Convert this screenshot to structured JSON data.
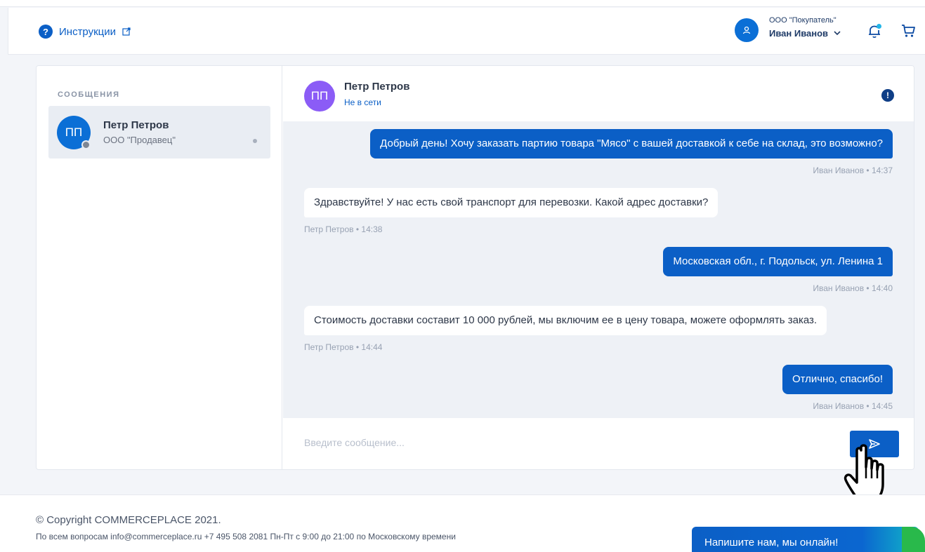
{
  "header": {
    "help_label": "Инструкции",
    "user": {
      "company": "ООО \"Покупатель\"",
      "name": "Иван Иванов"
    }
  },
  "sidebar": {
    "title": "СООБЩЕНИЯ",
    "contacts": [
      {
        "initials": "ПП",
        "name": "Петр Петров",
        "company": "ООО \"Продавец\""
      }
    ]
  },
  "chat": {
    "initials": "ПП",
    "name": "Петр Петров",
    "status": "Не в сети",
    "messages": [
      {
        "direction": "out",
        "text": "Добрый день! Хочу заказать партию товара  \"Мясо\"  с вашей доставкой к себе на склад, это возможно?",
        "meta": "Иван Иванов • 14:37"
      },
      {
        "direction": "in",
        "text": "Здравствуйте! У нас есть свой транспорт для перевозки. Какой адрес доставки?",
        "meta": "Петр Петров • 14:38"
      },
      {
        "direction": "out",
        "text": "Московская обл., г. Подольск, ул. Ленина 1",
        "meta": "Иван Иванов • 14:40"
      },
      {
        "direction": "in",
        "text": "Стоимость доставки составит 10 000 рублей, мы включим ее в цену товара, можете оформлять заказ.",
        "meta": "Петр Петров • 14:44"
      },
      {
        "direction": "out",
        "text": "Отлично, спасибо!",
        "meta": "Иван Иванов • 14:45"
      }
    ],
    "input_placeholder": "Введите сообщение..."
  },
  "footer": {
    "copyright": "© Copyright COMMERCEPLACE 2021.",
    "contacts": "По всем вопросам info@commerceplace.ru +7 495 508 2081 Пн-Пт с 9:00 до 21:00 по Московскому времени",
    "online_chat": "Напишите нам, мы онлайн!"
  },
  "colors": {
    "accent": "#0b5fc6",
    "purple_avatar": "#8b5cf6",
    "chat_bg": "#eef1f6"
  }
}
